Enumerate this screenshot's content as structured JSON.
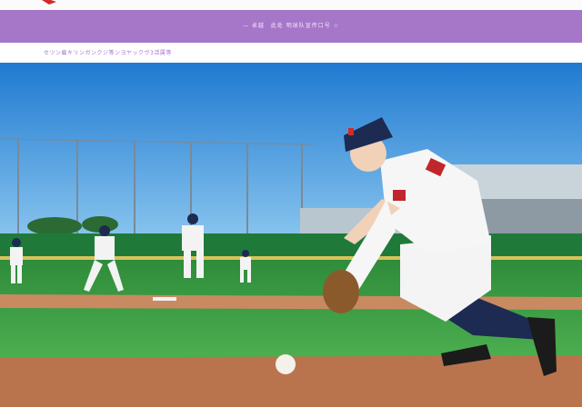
{
  "header": {
    "site_name": "",
    "nav_links": [
      "",
      "",
      ""
    ]
  },
  "banner": {
    "text": "— 卓越　此处 明球队宣传口号 ☆"
  },
  "subnav": {
    "text": "セツン雇キリンガンクジ等ンヨヤックヴ3活属等"
  },
  "hero": {
    "scene": "Young baseball fielder crouching with glove on an infield, teammates in the background",
    "icon": "hero-photo-icon"
  },
  "colors": {
    "banner": "#a676c9",
    "subnav_text": "#a874cf",
    "sky": "#3f96d8",
    "grass": "#3fa548",
    "dirt": "#b9744e",
    "cap": "#1d2a52",
    "logo": "#d22a2a"
  }
}
